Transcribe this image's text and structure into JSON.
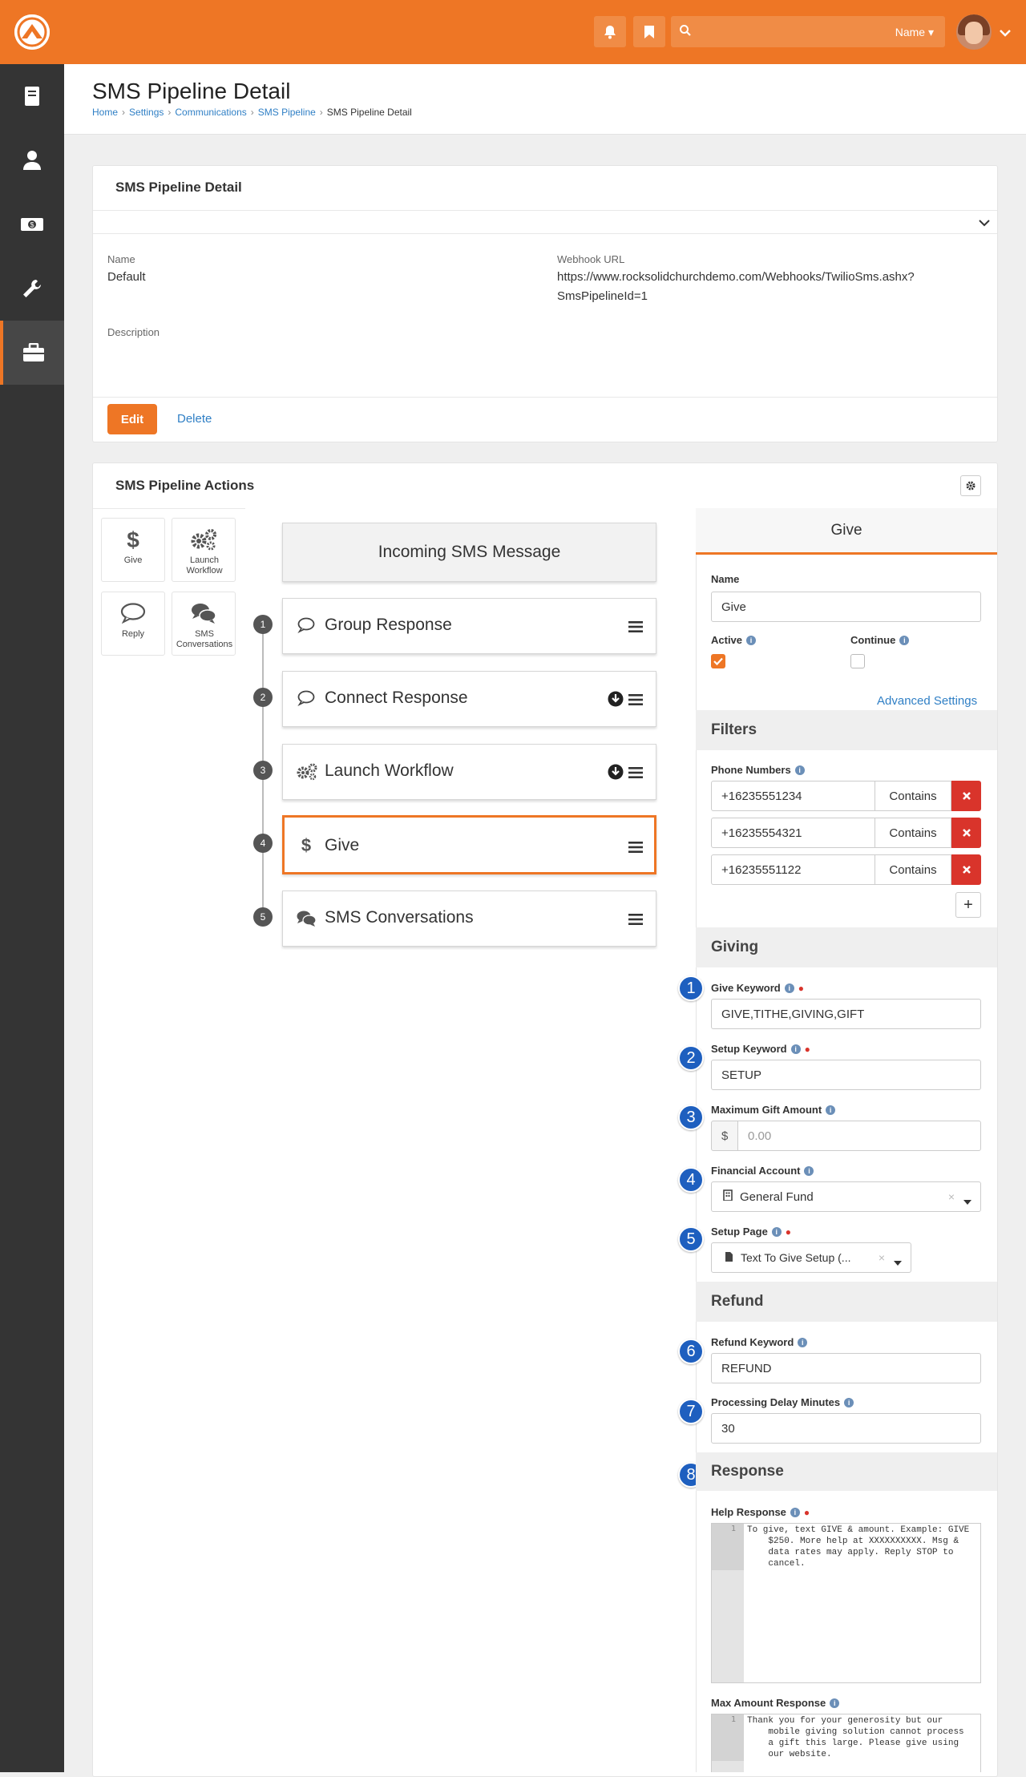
{
  "header": {
    "user_menu_label": "Name"
  },
  "page": {
    "title": "SMS Pipeline Detail",
    "breadcrumbs": [
      "Home",
      "Settings",
      "Communications",
      "SMS Pipeline",
      "SMS Pipeline Detail"
    ]
  },
  "detail": {
    "panel_title": "SMS Pipeline Detail",
    "name_label": "Name",
    "name_value": "Default",
    "webhook_label": "Webhook URL",
    "webhook_value_line1": "https://www.rocksolidchurchdemo.com/Webhooks/TwilioSms.ashx?",
    "webhook_value_line2": "SmsPipelineId=1",
    "description_label": "Description",
    "edit_label": "Edit",
    "delete_label": "Delete"
  },
  "actions_panel": {
    "title": "SMS Pipeline Actions",
    "components": [
      {
        "label": "Give",
        "icon": "dollar-icon"
      },
      {
        "label": "Launch Workflow",
        "icon": "gears-icon"
      },
      {
        "label": "Reply",
        "icon": "comment-icon"
      },
      {
        "label": "SMS Conversations",
        "icon": "comments-icon"
      }
    ],
    "incoming_label": "Incoming SMS Message",
    "flow": [
      {
        "num": "1",
        "label": "Group Response",
        "icon": "comment-icon"
      },
      {
        "num": "2",
        "label": "Connect Response",
        "icon": "comment-icon"
      },
      {
        "num": "3",
        "label": "Launch Workflow",
        "icon": "gears-icon"
      },
      {
        "num": "4",
        "label": "Give",
        "icon": "dollar-icon"
      },
      {
        "num": "5",
        "label": "SMS Conversations",
        "icon": "comments-icon"
      }
    ]
  },
  "settings": {
    "header": "Give",
    "name_label": "Name",
    "name_value": "Give",
    "active_label": "Active",
    "continue_label": "Continue",
    "active_checked": true,
    "continue_checked": false,
    "advanced_label": "Advanced Settings",
    "filters_title": "Filters",
    "phone_label": "Phone Numbers",
    "phones": [
      {
        "number": "+16235551234",
        "op": "Contains"
      },
      {
        "number": "+16235554321",
        "op": "Contains"
      },
      {
        "number": "+16235551122",
        "op": "Contains"
      }
    ],
    "add_label": "+",
    "giving_title": "Giving",
    "give_keyword_label": "Give Keyword",
    "give_keyword_value": "GIVE,TITHE,GIVING,GIFT",
    "setup_keyword_label": "Setup Keyword",
    "setup_keyword_value": "SETUP",
    "max_gift_label": "Maximum Gift Amount",
    "currency_symbol": "$",
    "max_gift_placeholder": "0.00",
    "account_label": "Financial Account",
    "account_value": "General Fund",
    "setup_page_label": "Setup Page",
    "setup_page_value": "Text To Give Setup (...",
    "refund_title": "Refund",
    "refund_keyword_label": "Refund Keyword",
    "refund_keyword_value": "REFUND",
    "delay_label": "Processing Delay Minutes",
    "delay_value": "30",
    "response_title": "Response",
    "help_label": "Help Response",
    "help_text": "To give, text GIVE & amount. Example: GIVE\n    $250. More help at XXXXXXXXXX. Msg &\n    data rates may apply. Reply STOP to\n    cancel.",
    "max_amount_label": "Max Amount Response",
    "max_amount_text": "Thank you for your generosity but our\n    mobile giving solution cannot process\n    a gift this large. Please give using\n    our website.",
    "line_number": "1",
    "callouts": [
      "1",
      "2",
      "3",
      "4",
      "5",
      "6",
      "7",
      "8"
    ]
  },
  "colors": {
    "brand": "#ee7625",
    "nav": "#343434",
    "link": "#2f7fc5",
    "danger": "#d9342b",
    "callout": "#1e5fbf"
  }
}
